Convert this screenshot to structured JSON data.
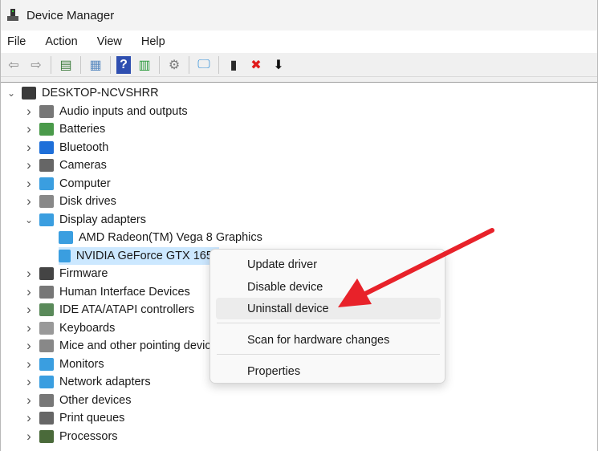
{
  "window": {
    "title": "Device Manager"
  },
  "menubar": [
    "File",
    "Action",
    "View",
    "Help"
  ],
  "toolbar": [
    {
      "icon": "back-arrow-icon",
      "glyph": "⇦",
      "color": "#888"
    },
    {
      "icon": "forward-arrow-icon",
      "glyph": "⇨",
      "color": "#888"
    },
    {
      "sep": true
    },
    {
      "icon": "show-hide-console-tree-icon",
      "glyph": "▤",
      "color": "#3a7a3a"
    },
    {
      "sep": true
    },
    {
      "icon": "properties-icon",
      "glyph": "▦",
      "color": "#5a8ac0"
    },
    {
      "sep": true
    },
    {
      "icon": "help-icon",
      "glyph": "?",
      "color": "#fff",
      "bg": "#2f4fb0"
    },
    {
      "icon": "show-action-pane-icon",
      "glyph": "▥",
      "color": "#2c9a3c"
    },
    {
      "sep": true
    },
    {
      "icon": "update-driver-icon",
      "glyph": "⚙",
      "color": "#7a7a7a"
    },
    {
      "sep": true
    },
    {
      "icon": "scan-hardware-icon",
      "glyph": "🖵",
      "color": "#2f8ed8"
    },
    {
      "sep": true
    },
    {
      "icon": "enable-device-icon",
      "glyph": "▮",
      "color": "#2a2a2a"
    },
    {
      "icon": "uninstall-icon",
      "glyph": "✖",
      "color": "#e01b1b"
    },
    {
      "icon": "disable-device-icon",
      "glyph": "⬇",
      "color": "#111"
    }
  ],
  "tree": [
    {
      "label": "DESKTOP-NCVSHRR",
      "depth": 0,
      "state": "expanded",
      "color": "#3a3a3a"
    },
    {
      "label": "Audio inputs and outputs",
      "depth": 1,
      "state": "collapsed",
      "color": "#777"
    },
    {
      "label": "Batteries",
      "depth": 1,
      "state": "collapsed",
      "color": "#4a9a4a"
    },
    {
      "label": "Bluetooth",
      "depth": 1,
      "state": "collapsed",
      "color": "#1e6fd9"
    },
    {
      "label": "Cameras",
      "depth": 1,
      "state": "collapsed",
      "color": "#666"
    },
    {
      "label": "Computer",
      "depth": 1,
      "state": "collapsed",
      "color": "#3a9ee0"
    },
    {
      "label": "Disk drives",
      "depth": 1,
      "state": "collapsed",
      "color": "#888"
    },
    {
      "label": "Display adapters",
      "depth": 1,
      "state": "expanded",
      "color": "#3a9ee0"
    },
    {
      "label": "AMD Radeon(TM) Vega 8 Graphics",
      "depth": 2,
      "state": "leaf",
      "color": "#3a9ee0"
    },
    {
      "label": "NVIDIA GeForce GTX 1650",
      "depth": 2,
      "state": "leaf",
      "selected": true,
      "color": "#3a9ee0"
    },
    {
      "label": "Firmware",
      "depth": 1,
      "state": "collapsed",
      "color": "#444"
    },
    {
      "label": "Human Interface Devices",
      "depth": 1,
      "state": "collapsed",
      "color": "#777"
    },
    {
      "label": "IDE ATA/ATAPI controllers",
      "depth": 1,
      "state": "collapsed",
      "color": "#5a8a5a"
    },
    {
      "label": "Keyboards",
      "depth": 1,
      "state": "collapsed",
      "color": "#999"
    },
    {
      "label": "Mice and other pointing devices",
      "depth": 1,
      "state": "collapsed",
      "color": "#888"
    },
    {
      "label": "Monitors",
      "depth": 1,
      "state": "collapsed",
      "color": "#3a9ee0"
    },
    {
      "label": "Network adapters",
      "depth": 1,
      "state": "collapsed",
      "color": "#3a9ee0"
    },
    {
      "label": "Other devices",
      "depth": 1,
      "state": "collapsed",
      "color": "#777"
    },
    {
      "label": "Print queues",
      "depth": 1,
      "state": "collapsed",
      "color": "#666"
    },
    {
      "label": "Processors",
      "depth": 1,
      "state": "collapsed",
      "color": "#4a6a3a"
    }
  ],
  "context_menu": {
    "items": [
      {
        "label": "Update driver"
      },
      {
        "label": "Disable device"
      },
      {
        "label": "Uninstall device",
        "highlighted": true
      },
      {
        "label": "Scan for hardware changes"
      },
      {
        "label": "Properties"
      }
    ]
  },
  "annotation": {
    "arrow_color": "#e8222a"
  }
}
